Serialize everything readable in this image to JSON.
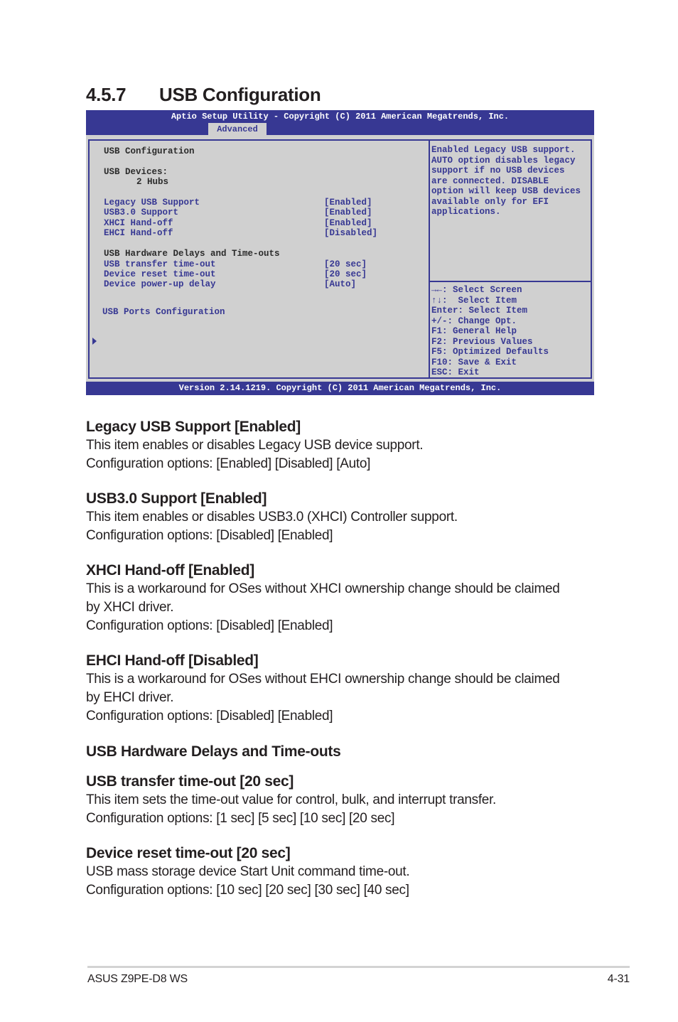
{
  "section": {
    "number": "4.5.7",
    "title": "USB Configuration"
  },
  "bios": {
    "title": "Aptio Setup Utility - Copyright (C) 2011 American Megatrends, Inc.",
    "active_tab": "Advanced",
    "version": "Version 2.14.1219. Copyright (C) 2011 American Megatrends, Inc.",
    "heading": "USB Configuration",
    "devices_label": "USB Devices:",
    "devices_value": "2 Hubs",
    "settings": [
      {
        "label": "Legacy USB Support",
        "value": "[Enabled]"
      },
      {
        "label": "USB3.0 Support",
        "value": "[Enabled]"
      },
      {
        "label": "XHCI Hand-off",
        "value": "[Enabled]"
      },
      {
        "label": "EHCI Hand-off",
        "value": "[Disabled]"
      }
    ],
    "delays_heading": "USB Hardware Delays and Time-outs",
    "delays": [
      {
        "label": "USB transfer time-out",
        "value": "[20 sec]"
      },
      {
        "label": "Device reset time-out",
        "value": "[20 sec]"
      },
      {
        "label": "Device power-up delay",
        "value": "[Auto]"
      }
    ],
    "submenu": "USB Ports Configuration",
    "help_lines": [
      "Enabled Legacy USB support.",
      "AUTO option disables legacy",
      "support if no USB devices",
      "are connected. DISABLE",
      "option will keep USB devices",
      "available only for EFI",
      "applications."
    ],
    "key_lines": [
      "→←: Select Screen",
      "↑↓:  Select Item",
      "Enter: Select Item",
      "+/-: Change Opt.",
      "F1: General Help",
      "F2: Previous Values",
      "F5: Optimized Defaults",
      "F10: Save & Exit",
      "ESC: Exit"
    ]
  },
  "doc": {
    "legacy": {
      "heading": "Legacy USB Support [Enabled]",
      "lines": [
        "This item enables or disables Legacy USB device support.",
        "Configuration options: [Enabled] [Disabled] [Auto]"
      ]
    },
    "usb3": {
      "heading": "USB3.0 Support [Enabled]",
      "lines": [
        "This item enables or disables USB3.0 (XHCI) Controller support.",
        "Configuration options: [Disabled] [Enabled]"
      ]
    },
    "xhci": {
      "heading": "XHCI Hand-off [Enabled]",
      "lines": [
        "This is a workaround for OSes without XHCI ownership change should be claimed",
        "by XHCI driver.",
        "Configuration options: [Disabled] [Enabled]"
      ]
    },
    "ehci": {
      "heading": "EHCI Hand-off [Disabled]",
      "lines": [
        "This is a workaround for OSes without EHCI ownership change should be claimed",
        "by EHCI driver.",
        "Configuration options: [Disabled] [Enabled]"
      ]
    },
    "delays_heading": "USB Hardware Delays and Time-outs",
    "transfer": {
      "heading": "USB transfer time-out [20 sec]",
      "lines": [
        "This item sets the time-out value for control, bulk, and interrupt transfer.",
        "Configuration options: [1 sec] [5 sec] [10 sec] [20 sec]"
      ]
    },
    "reset": {
      "heading": "Device reset time-out [20 sec]",
      "lines": [
        "USB mass storage device Start Unit command time-out.",
        "Configuration options: [10 sec] [20 sec] [30 sec] [40 sec]"
      ]
    }
  },
  "footer": {
    "model": "ASUS Z9PE-D8 WS",
    "page": "4-31"
  }
}
